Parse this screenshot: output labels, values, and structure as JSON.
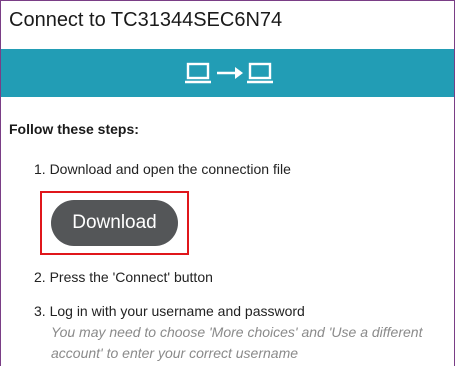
{
  "title": "Connect to TC31344SEC6N74",
  "banner": {
    "icons": [
      "laptop-icon",
      "arrow-right-icon",
      "laptop-icon"
    ],
    "color": "#229db5"
  },
  "steps_heading": "Follow these steps:",
  "steps": [
    "1. Download and open the connection file",
    "2. Press the 'Connect' button",
    "3. Log in with your username and password"
  ],
  "download_button": "Download",
  "hint_lines": [
    "You may need to choose 'More choices' and 'Use a different",
    "account' to enter your correct username"
  ],
  "highlight_color": "#e0161b"
}
